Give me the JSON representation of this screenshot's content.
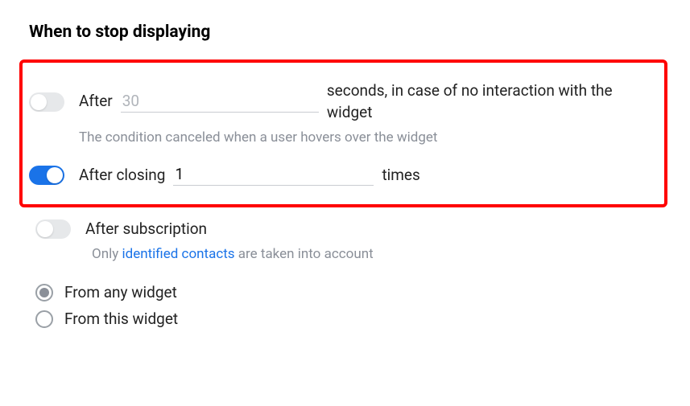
{
  "section": {
    "title": "When to stop displaying"
  },
  "options": {
    "after_seconds": {
      "toggle": false,
      "prefix": "After",
      "value": "30",
      "suffix": "seconds, in case of no interaction with the widget",
      "hint": "The condition canceled when a user hovers over the widget"
    },
    "after_closing": {
      "toggle": true,
      "prefix": "After closing",
      "value": "1",
      "suffix": "times"
    },
    "after_subscription": {
      "toggle": false,
      "label": "After subscription",
      "hint_before": "Only ",
      "hint_link": "identified contacts",
      "hint_after": " are taken into account"
    }
  },
  "scope": {
    "selected": "any",
    "any_label": "From any widget",
    "this_label": "From this widget"
  }
}
